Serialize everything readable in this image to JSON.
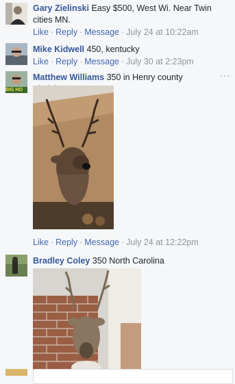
{
  "actions": {
    "like": "Like",
    "reply": "Reply",
    "message": "Message",
    "separator": "·"
  },
  "comments": [
    {
      "author": "Gary Zielinski",
      "text": "Easy $500, West Wi. Near Twin cities MN.",
      "timestamp": "July 24 at 10:22am"
    },
    {
      "author": "Mike Kidwell",
      "text": "450, kentucky",
      "timestamp": "July 30 at 2:23pm"
    },
    {
      "author": "Matthew Williams",
      "text": "350 in Henry county Virginia",
      "timestamp": "July 24 at 12:22pm",
      "avatar_badge": "BIG HO",
      "more_icon": "···"
    },
    {
      "author": "Bradley Coley",
      "text": "350 North Carolina"
    }
  ]
}
